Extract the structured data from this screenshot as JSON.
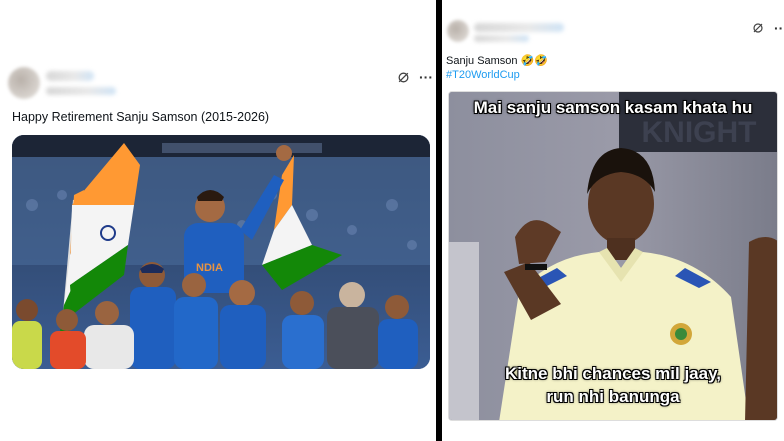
{
  "left_post": {
    "text": "Happy Retirement Sanju Samson (2015-2026)",
    "actions": {
      "grok_icon": "grok-icon",
      "more_label": "···"
    }
  },
  "right_post": {
    "line1": "Sanju Samson 🤣🤣",
    "hashtag": "#T20WorldCup",
    "actions": {
      "grok_icon": "grok-icon",
      "more_label": "···"
    },
    "meme": {
      "top_caption": "Mai sanju samson kasam khata hu",
      "bottom_caption_line1": "Kitne bhi chances mil jaay,",
      "bottom_caption_line2": "run nhi banunga"
    }
  },
  "colors": {
    "divider": "#000000",
    "hashtag": "#1d9bf0",
    "india_blue": "#1f5fbf",
    "saffron": "#ff9933",
    "green": "#138808"
  }
}
